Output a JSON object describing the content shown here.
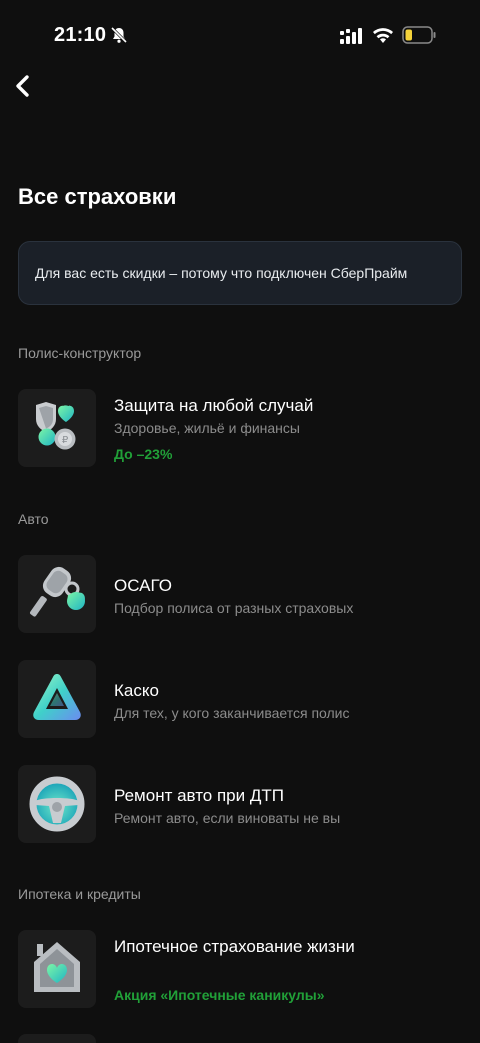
{
  "status_bar": {
    "time": "21:10",
    "icons": [
      "bell-off-icon",
      "signal-icon",
      "wifi-icon",
      "battery-low-icon"
    ],
    "battery_color": "#f5d33a"
  },
  "nav": {
    "back_icon": "chevron-left-icon"
  },
  "page": {
    "title": "Все страховки",
    "banner_text": "Для вас есть скидки – потому что подключен СберПрайм"
  },
  "sections": [
    {
      "label": "Полис-конструктор",
      "items": [
        {
          "title": "Защита на любой случай",
          "subtitle": "Здоровье, жильё и финансы",
          "promo": "До –23%",
          "icon": "shield-heart-icon"
        }
      ]
    },
    {
      "label": "Авто",
      "items": [
        {
          "title": "ОСАГО",
          "subtitle": "Подбор полиса от разных страховых",
          "icon": "car-key-icon"
        },
        {
          "title": "Каско",
          "subtitle": "Для тех, у кого заканчивается полис",
          "icon": "warning-triangle-icon"
        },
        {
          "title": "Ремонт авто при ДТП",
          "subtitle": "Ремонт авто, если виноваты не вы",
          "icon": "steering-wheel-icon"
        }
      ]
    },
    {
      "label": "Ипотека и кредиты",
      "items": [
        {
          "title": "Ипотечное страхование жизни",
          "promo": "Акция «Ипотечные каникулы»",
          "icon": "house-heart-icon"
        }
      ]
    }
  ],
  "colors": {
    "accent_green": "#21a038",
    "background": "#0f0f0f",
    "banner_bg": "#1b2028"
  }
}
